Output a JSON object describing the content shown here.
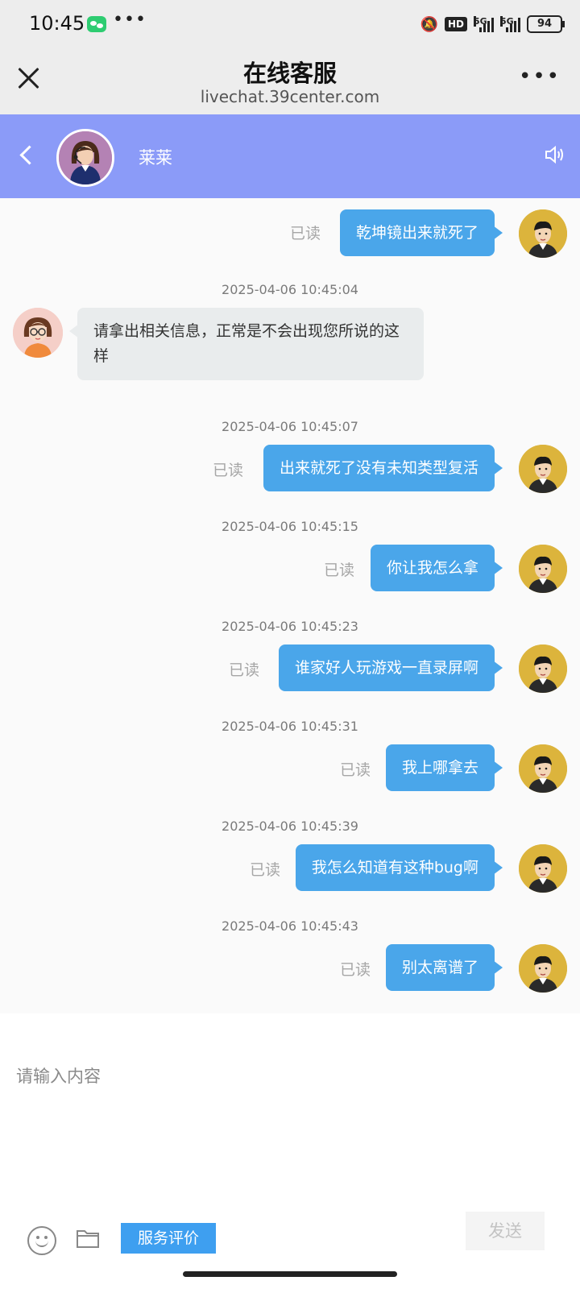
{
  "status_bar": {
    "time": "10:45",
    "hd_badge": "HD",
    "net_1": "5G",
    "net_2": "5G",
    "battery": "94"
  },
  "browser": {
    "title": "在线客服",
    "url": "livechat.39center.com"
  },
  "chat_header": {
    "agent_name": "莱莱"
  },
  "messages": [
    {
      "from": "user",
      "text": "乾坤镜出来就死了",
      "status": "已读"
    },
    {
      "timestamp": "2025-04-06 10:45:04"
    },
    {
      "from": "agent",
      "text": "请拿出相关信息，正常是不会出现您所说的这样"
    },
    {
      "timestamp": "2025-04-06 10:45:07"
    },
    {
      "from": "user",
      "text": "出来就死了没有未知类型复活",
      "status": "已读"
    },
    {
      "timestamp": "2025-04-06 10:45:15"
    },
    {
      "from": "user",
      "text": "你让我怎么拿",
      "status": "已读"
    },
    {
      "timestamp": "2025-04-06 10:45:23"
    },
    {
      "from": "user",
      "text": "谁家好人玩游戏一直录屏啊",
      "status": "已读"
    },
    {
      "timestamp": "2025-04-06 10:45:31"
    },
    {
      "from": "user",
      "text": "我上哪拿去",
      "status": "已读"
    },
    {
      "timestamp": "2025-04-06 10:45:39"
    },
    {
      "from": "user",
      "text": "我怎么知道有这种bug啊",
      "status": "已读"
    },
    {
      "timestamp": "2025-04-06 10:45:43"
    },
    {
      "from": "user",
      "text": "别太离谱了",
      "status": "已读"
    }
  ],
  "composer": {
    "placeholder": "请输入内容",
    "rate_label": "服务评价",
    "send_label": "发送"
  },
  "icons": [
    "wechat-icon",
    "bell-off-icon",
    "signal-icon",
    "battery-icon",
    "close-icon",
    "more-icon",
    "back-icon",
    "speaker-icon",
    "emoji-icon",
    "folder-icon"
  ],
  "colors": {
    "header_bg": "#8b9bf8",
    "user_bubble": "#4aa6ea",
    "agent_bubble": "#e9eced",
    "rate_button": "#3e9ff0"
  }
}
